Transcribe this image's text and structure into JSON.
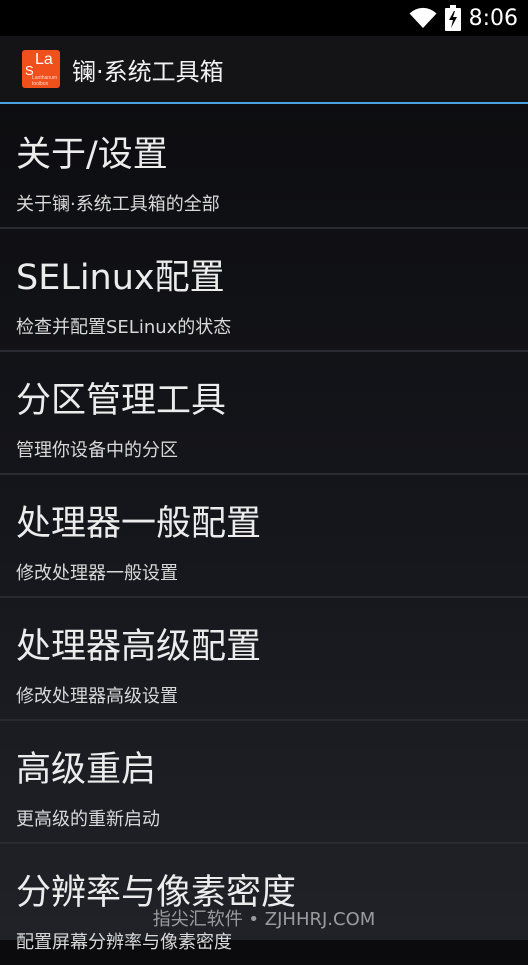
{
  "status_bar": {
    "time": "8:06",
    "icons": [
      "wifi-icon",
      "battery-charging-icon"
    ]
  },
  "action_bar": {
    "logo_text_top": "La",
    "logo_text_left": "S",
    "logo_text_small": "Lanthanum toolbox",
    "title": "镧·系统工具箱"
  },
  "menu": {
    "items": [
      {
        "title": "关于/设置",
        "subtitle": "关于镧·系统工具箱的全部"
      },
      {
        "title": "SELinux配置",
        "subtitle": "检查并配置SELinux的状态"
      },
      {
        "title": "分区管理工具",
        "subtitle": "管理你设备中的分区"
      },
      {
        "title": "处理器一般配置",
        "subtitle": "修改处理器一般设置"
      },
      {
        "title": "处理器高级配置",
        "subtitle": "修改处理器高级设置"
      },
      {
        "title": "高级重启",
        "subtitle": "更高级的重新启动"
      },
      {
        "title": "分辨率与像素密度",
        "subtitle": "配置屏幕分辨率与像素密度"
      }
    ]
  },
  "watermark": "指尖汇软件 • ZJHHRJ.COM"
}
